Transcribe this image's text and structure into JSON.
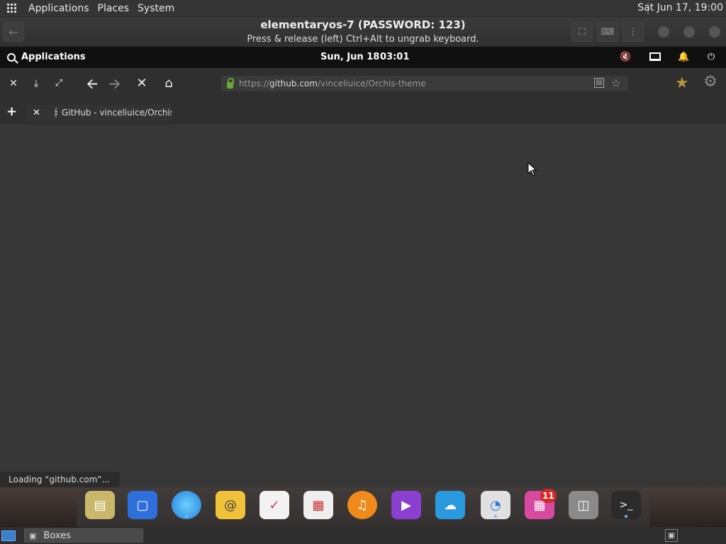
{
  "host_panel": {
    "menus": [
      "Applications",
      "Places",
      "System"
    ],
    "clock": "Sat Jun 17, 19:00"
  },
  "boxes": {
    "title": "elementaryos-7 (PASSWORD: 123)",
    "subtitle": "Press & release (left) Ctrl+Alt to ungrab keyboard."
  },
  "guest_panel": {
    "applications_label": "Applications",
    "date": "Sun, Jun 18",
    "time": "03:01"
  },
  "browser": {
    "url_scheme": "https://",
    "url_host": "github.com",
    "url_path": "/vinceliuice/Orchis-theme",
    "tab_title": "GitHub - vinceliuice/Orchis-theme",
    "status": "Loading “github.com”..."
  },
  "dock": {
    "items": [
      {
        "name": "files",
        "icon": "file-cabinet-icon",
        "color": "#c9b86a"
      },
      {
        "name": "multitasking",
        "icon": "windows-icon",
        "color": "#2f6fdc"
      },
      {
        "name": "web-browser",
        "icon": "globe-icon",
        "color": "#3aa0e8"
      },
      {
        "name": "mail",
        "icon": "mail-icon",
        "color": "#f0c23a"
      },
      {
        "name": "tasks",
        "icon": "checklist-icon",
        "color": "#e8e8e8"
      },
      {
        "name": "calendar",
        "icon": "calendar-icon",
        "color": "#e8e8e8"
      },
      {
        "name": "music",
        "icon": "music-note-icon",
        "color": "#f08a1a"
      },
      {
        "name": "videos",
        "icon": "play-icon",
        "color": "#8b3fd1"
      },
      {
        "name": "photos",
        "icon": "photos-icon",
        "color": "#2a9ae0"
      },
      {
        "name": "settings",
        "icon": "toggle-icon",
        "color": "#d8d8d8"
      },
      {
        "name": "appcenter",
        "icon": "store-icon",
        "color": "#d84aa0",
        "badge": "11"
      },
      {
        "name": "trash",
        "icon": "trash-icon",
        "color": "#8a8a8a"
      },
      {
        "name": "terminal",
        "icon": "terminal-icon",
        "color": "#2b2b2b"
      }
    ]
  },
  "host_taskbar": {
    "task_label": "Boxes"
  }
}
